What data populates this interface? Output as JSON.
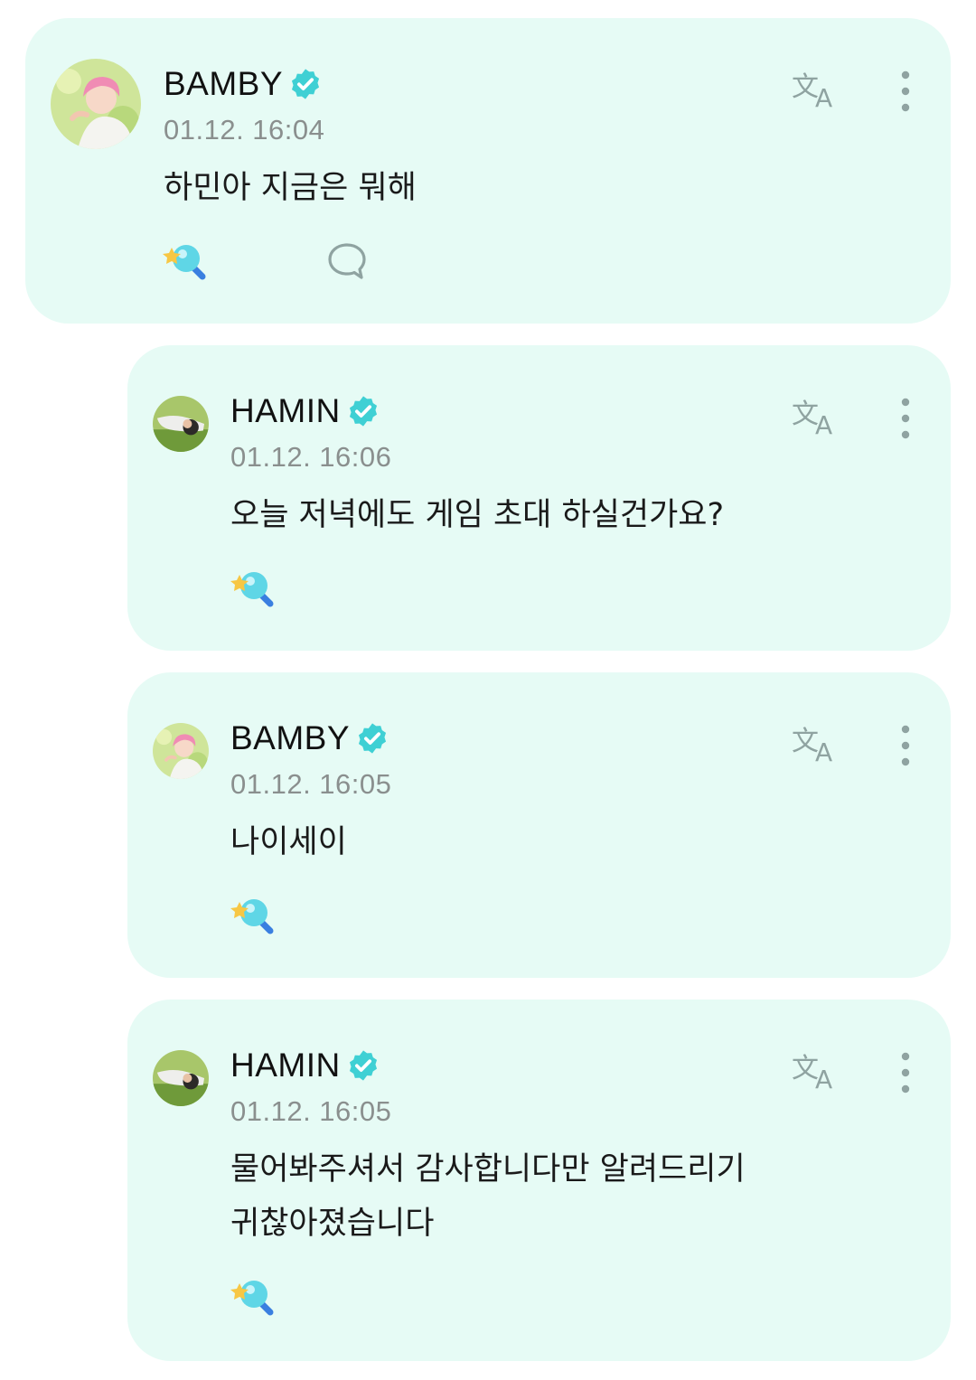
{
  "posts": [
    {
      "author": "BAMBY",
      "verified": true,
      "timestamp": "01.12. 16:04",
      "message": "하민아 지금은 뭐해",
      "avatar": "pink-hair-artist-avatar",
      "actions": [
        "translate-icon",
        "more-vertical-icon",
        "lightstick-reaction-icon",
        "comment-bubble-icon"
      ]
    },
    {
      "author": "HAMIN",
      "verified": true,
      "timestamp": "01.12. 16:06",
      "message": "오늘 저녁에도 게임 초대 하실건가요?",
      "avatar": "lying-in-grass-avatar",
      "actions": [
        "translate-icon",
        "more-vertical-icon",
        "lightstick-reaction-icon"
      ]
    },
    {
      "author": "BAMBY",
      "verified": true,
      "timestamp": "01.12. 16:05",
      "message": "나이세이",
      "avatar": "pink-hair-artist-avatar",
      "actions": [
        "translate-icon",
        "more-vertical-icon",
        "lightstick-reaction-icon"
      ]
    },
    {
      "author": "HAMIN",
      "verified": true,
      "timestamp": "01.12. 16:05",
      "message_lines": [
        "물어봐주셔서 감사합니다만 알려드리기",
        "귀찮아졌습니다"
      ],
      "avatar": "lying-in-grass-avatar",
      "actions": [
        "translate-icon",
        "more-vertical-icon",
        "lightstick-reaction-icon"
      ]
    }
  ],
  "colors": {
    "card_background": "#e6fbf5",
    "verified_badge": "#3fd0d4",
    "timestamp": "#8a8f8e",
    "icon_gray": "#8fa3a1"
  }
}
